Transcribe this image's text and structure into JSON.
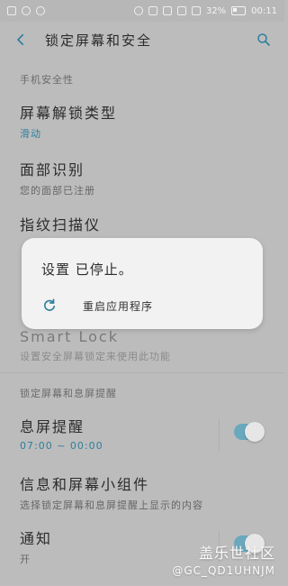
{
  "status_bar": {
    "battery": "32%",
    "time": "00:11",
    "left_icons": [
      "message-icon",
      "smiley-icon",
      "notification-icon"
    ],
    "right_icons": [
      "sync-icon",
      "nfc-icon",
      "mute-icon",
      "sim-icon",
      "signal-icon",
      "battery-icon"
    ]
  },
  "appbar": {
    "title": "锁定屏幕和安全"
  },
  "sections": {
    "phone_security": "手机安全性",
    "lock_and_aod": "锁定屏幕和息屏提醒"
  },
  "items": {
    "screen_lock_type": {
      "title": "屏幕解锁类型",
      "subtitle": "滑动"
    },
    "face_recognition": {
      "title": "面部识别",
      "subtitle": "您的面部已注册"
    },
    "fingerprint": {
      "title": "指纹扫描仪",
      "subtitle": ""
    },
    "smart_lock": {
      "title": "Smart Lock",
      "subtitle": "设置安全屏幕锁定来使用此功能"
    },
    "always_on_display": {
      "title": "息屏提醒",
      "subtitle": "07:00 ~ 00:00",
      "toggle_on": true
    },
    "info_widgets": {
      "title": "信息和屏幕小组件",
      "subtitle": "选择锁定屏幕和息屏提醒上显示的内容"
    },
    "notifications": {
      "title": "通知",
      "subtitle": "开",
      "toggle_on": true
    }
  },
  "dialog": {
    "title": "设置 已停止。",
    "action_label": "重启应用程序",
    "action_icon": "refresh-icon"
  },
  "watermark": {
    "line1": "盖乐世社区",
    "line2": "@GC_QD1UHNJM"
  },
  "colors": {
    "background_dim": "#bcbcbc",
    "dialog_bg": "#f2f2f2",
    "accent": "#2f7f9c",
    "toggle": "#6aa8be"
  }
}
